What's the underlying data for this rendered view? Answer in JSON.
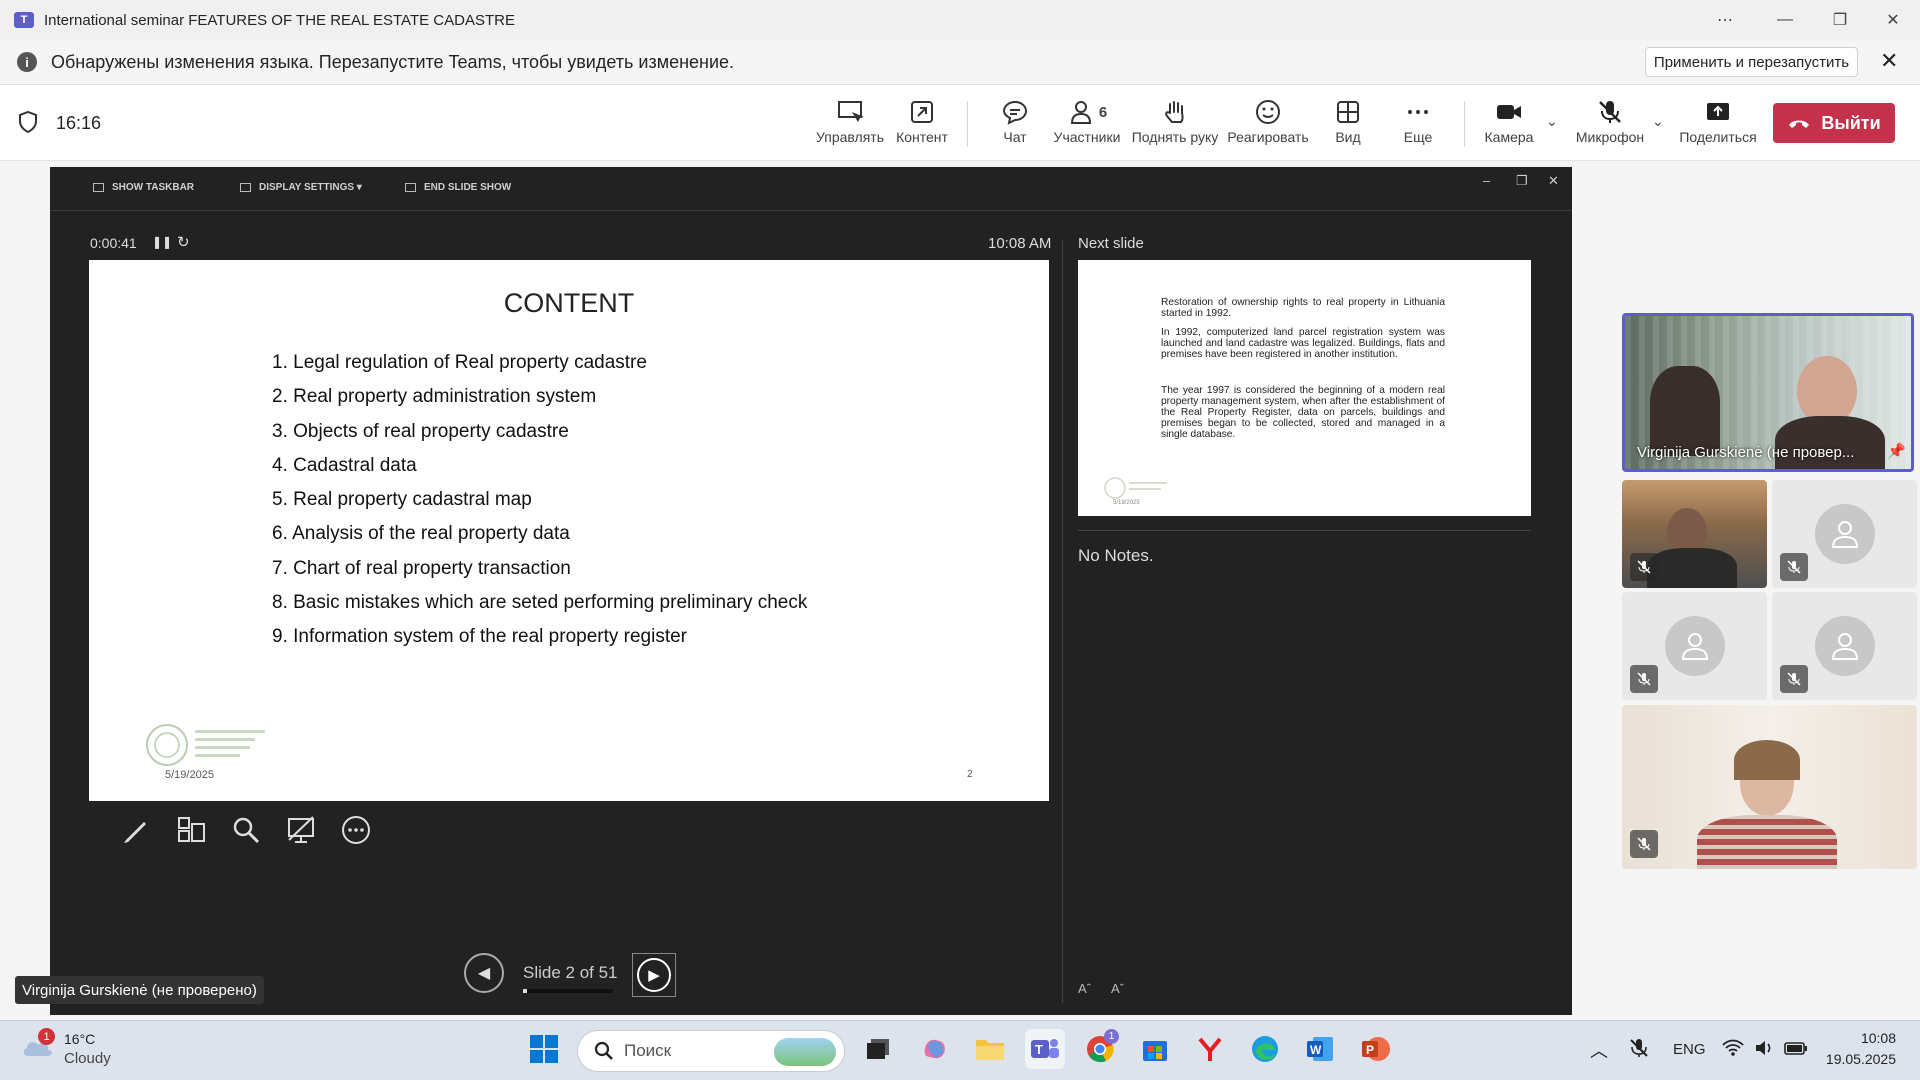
{
  "window": {
    "title": "International seminar FEATURES OF THE REAL ESTATE CADASTRE",
    "app_icon": "teams-icon"
  },
  "infobar": {
    "message": "Обнаружены изменения языка. Перезапустите Teams, чтобы увидеть изменение.",
    "restart_label": "Применить и перезапустить"
  },
  "meeting": {
    "elapsed": "16:16",
    "controls": {
      "manage": "Управлять",
      "content": "Контент",
      "chat": "Чат",
      "participants": "Участники",
      "participants_count": "6",
      "raise_hand": "Поднять руку",
      "react": "Реагировать",
      "view": "Вид",
      "more": "Еще",
      "camera": "Камера",
      "mic": "Микрофон",
      "share": "Поделиться",
      "leave": "Выйти"
    }
  },
  "presenter": {
    "toolbar": {
      "show_taskbar": "SHOW TASKBAR",
      "display_settings": "DISPLAY SETTINGS ▾",
      "end_show": "END SLIDE SHOW"
    },
    "timer": "0:00:41",
    "clock": "10:08 AM",
    "next_label": "Next slide",
    "notes": "No Notes.",
    "slide_counter": "Slide 2 of 51",
    "progress_fraction": 0.039
  },
  "slide": {
    "title": "CONTENT",
    "items": [
      "1. Legal regulation of Real property cadastre",
      "2. Real property administration system",
      "3. Objects of real property cadastre",
      "4. Cadastral data",
      "5. Real property cadastral map",
      "6. Analysis of the real property data",
      "7. Chart of real property transaction",
      "8. Basic mistakes which are seted performing preliminary check",
      "9. Information system of the real property register"
    ],
    "date": "5/19/2025",
    "number": "2"
  },
  "next_slide": {
    "p1": "Restoration of ownership rights to real property in Lithuania started in 1992.",
    "p2": "In 1992, computerized land parcel registration system was launched and land cadastre was legalized. Buildings, flats and premises have been registered in another institution.",
    "p3": "The year 1997 is considered the beginning of a modern real property management system, when after the establishment of the Real Property Register, data on parcels, buildings and premises began to be collected, stored and managed in a single database."
  },
  "participants": {
    "pinned_name": "Virginija Gurskienė (не провер...",
    "presenter_label": "Virginija Gurskienė (не проверено)"
  },
  "taskbar": {
    "weather_temp": "16°C",
    "weather_desc": "Cloudy",
    "weather_badge": "1",
    "search_placeholder": "Поиск",
    "lang": "ENG",
    "time": "10:08",
    "date": "19.05.2025",
    "chrome_badge": "1"
  },
  "colors": {
    "accent": "#5b5fc7",
    "leave": "#c4314b",
    "presenter_bg": "#222222"
  }
}
